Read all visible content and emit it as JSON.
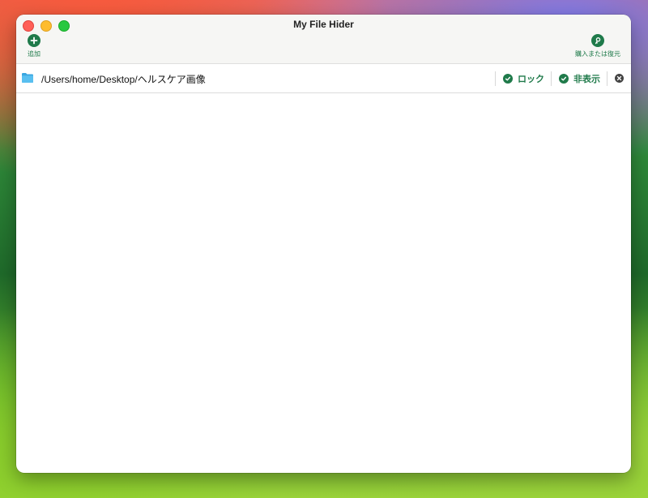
{
  "window": {
    "title": "My File Hider"
  },
  "toolbar": {
    "add_label": "追加",
    "restore_label": "購入または復元"
  },
  "items": [
    {
      "path": "/Users/home/Desktop/ヘルスケア画像",
      "lock_label": "ロック",
      "hide_label": "非表示",
      "lock_checked": true,
      "hide_checked": true
    }
  ],
  "colors": {
    "accent": "#1f7a4a"
  },
  "icons": {
    "add": "plus-circle-icon",
    "restore": "key-circle-icon",
    "folder": "folder-icon",
    "check": "checkmark-circle-icon",
    "remove": "close-circle-icon"
  }
}
